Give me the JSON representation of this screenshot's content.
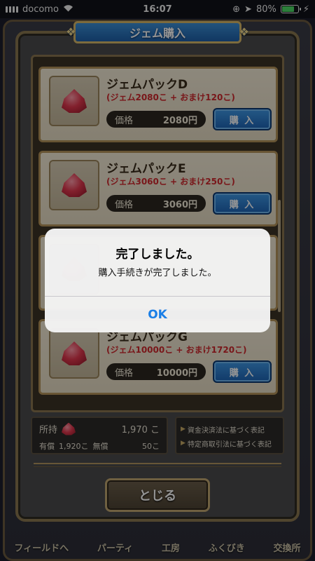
{
  "status_bar": {
    "carrier": "docomo",
    "time": "16:07",
    "battery": "80%",
    "battery_level": 0.8
  },
  "screen": {
    "title": "ジェム購入"
  },
  "packs": [
    {
      "name": "ジェムパックD",
      "bonus": "(ジェム2080こ + おまけ120こ)",
      "price_label": "価格",
      "price": "2080円",
      "buy_label": "購 入"
    },
    {
      "name": "ジェムパックE",
      "bonus": "(ジェム3060こ + おまけ250こ)",
      "price_label": "価格",
      "price": "3060円",
      "buy_label": "購 入"
    },
    {
      "name": "ジェムパックG",
      "bonus": "(ジェム10000こ + おまけ1720こ)",
      "price_label": "価格",
      "price": "10000円",
      "buy_label": "購 入"
    }
  ],
  "holdings": {
    "label": "所持",
    "total": "1,970 こ",
    "paid_label": "有償",
    "paid": "1,920こ",
    "free_label": "無償",
    "free": "50こ"
  },
  "legal_links": [
    "資金決済法に基づく表記",
    "特定商取引法に基づく表記"
  ],
  "close_label": "とじる",
  "bottom_nav": [
    "フィールドへ",
    "パーティ",
    "工房",
    "ふくびき",
    "交換所"
  ],
  "alert": {
    "title": "完了しました。",
    "message": "購入手続きが完了しました。",
    "ok_label": "OK"
  },
  "colors": {
    "bonus_text": "#d0282e",
    "buy_button": "#1d63b5",
    "alert_button": "#1a7ee6"
  }
}
